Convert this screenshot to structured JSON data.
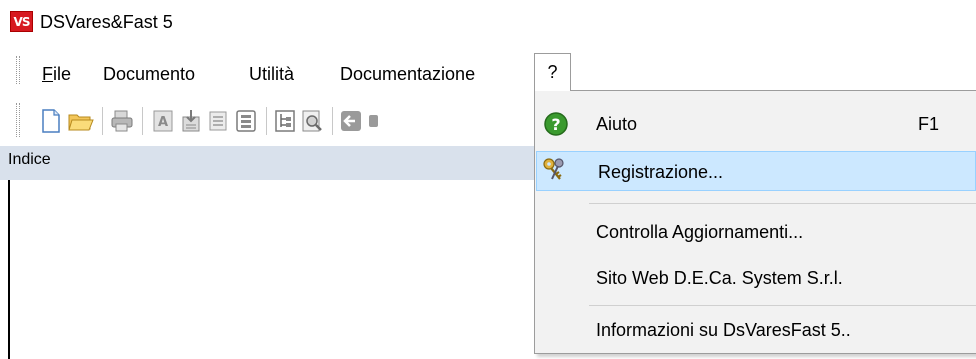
{
  "window": {
    "logo_text": "VS",
    "title": "DSVares&Fast 5"
  },
  "menubar": {
    "file_first": "F",
    "file_rest": "ile",
    "documento": "Documento",
    "utilita": "Utilità",
    "documentazione": "Documentazione",
    "help": "?"
  },
  "toolbar": {
    "icons": [
      "new-document-icon",
      "open-folder-icon",
      "print-icon",
      "text-style-icon",
      "import-icon",
      "list-icon",
      "details-icon",
      "tree-icon",
      "preview-icon",
      "back-arrow-icon",
      "forward-icon"
    ]
  },
  "panel": {
    "index_label": "Indice"
  },
  "help_menu": {
    "aiuto": "Aiuto",
    "aiuto_shortcut": "F1",
    "registrazione": "Registrazione...",
    "controlla": "Controlla Aggiornamenti...",
    "sito": "Sito Web D.E.Ca. System S.r.l.",
    "info": "Informazioni su DsVaresFast 5.."
  },
  "colors": {
    "logo_red": "#d71920",
    "index_header_bg": "#d9e1ec",
    "highlight_bg": "#cce8ff",
    "highlight_border": "#99d1ff",
    "menu_bg": "#f2f2f2",
    "help_icon_green": "#3a9a2e"
  }
}
